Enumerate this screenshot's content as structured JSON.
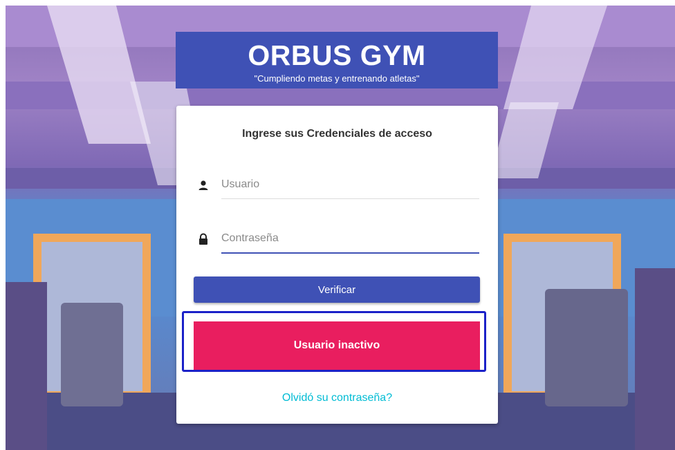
{
  "header": {
    "title": "ORBUS GYM",
    "subtitle": "\"Cumpliendo metas y entrenando atletas\""
  },
  "login": {
    "heading": "Ingrese sus Credenciales de acceso",
    "username": {
      "placeholder": "Usuario",
      "value": "",
      "icon": "user-icon"
    },
    "password": {
      "placeholder": "Contraseña",
      "value": "",
      "icon": "lock-icon"
    },
    "verify_label": "Verificar",
    "alert_message": "Usuario inactivo",
    "forgot_link": "Olvidó su contraseña?"
  },
  "colors": {
    "primary": "#3f51b5",
    "alert": "#e91e5f",
    "link": "#00bcd4",
    "highlight_frame": "#1b21c8"
  }
}
